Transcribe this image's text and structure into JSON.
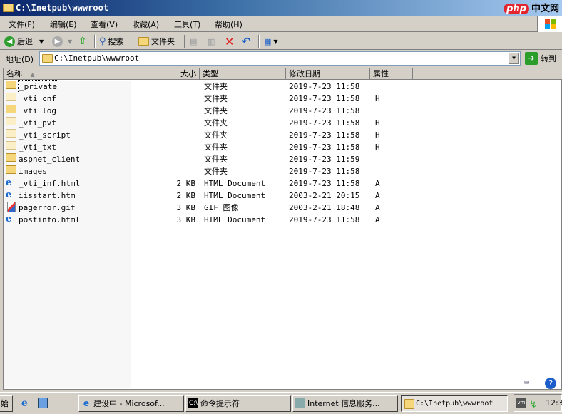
{
  "window": {
    "title": "C:\\Inetpub\\wwwroot",
    "watermark": "php中文网"
  },
  "menu": [
    "文件(F)",
    "编辑(E)",
    "查看(V)",
    "收藏(A)",
    "工具(T)",
    "帮助(H)"
  ],
  "toolbar": {
    "back": "后退",
    "search": "搜索",
    "folders": "文件夹"
  },
  "address": {
    "label": "地址(D)",
    "value": "C:\\Inetpub\\wwwroot",
    "go": "转到"
  },
  "columns": [
    "名称",
    "大小",
    "类型",
    "修改日期",
    "属性"
  ],
  "files": [
    {
      "name": "_private",
      "size": "",
      "type": "文件夹",
      "date": "2019-7-23 11:58",
      "attr": "",
      "icon": "folder"
    },
    {
      "name": "_vti_cnf",
      "size": "",
      "type": "文件夹",
      "date": "2019-7-23 11:58",
      "attr": "H",
      "icon": "folder-hidden"
    },
    {
      "name": "_vti_log",
      "size": "",
      "type": "文件夹",
      "date": "2019-7-23 11:58",
      "attr": "",
      "icon": "folder"
    },
    {
      "name": "_vti_pvt",
      "size": "",
      "type": "文件夹",
      "date": "2019-7-23 11:58",
      "attr": "H",
      "icon": "folder-hidden"
    },
    {
      "name": "_vti_script",
      "size": "",
      "type": "文件夹",
      "date": "2019-7-23 11:58",
      "attr": "H",
      "icon": "folder-hidden"
    },
    {
      "name": "_vti_txt",
      "size": "",
      "type": "文件夹",
      "date": "2019-7-23 11:58",
      "attr": "H",
      "icon": "folder-hidden"
    },
    {
      "name": "aspnet_client",
      "size": "",
      "type": "文件夹",
      "date": "2019-7-23 11:59",
      "attr": "",
      "icon": "folder"
    },
    {
      "name": "images",
      "size": "",
      "type": "文件夹",
      "date": "2019-7-23 11:58",
      "attr": "",
      "icon": "folder"
    },
    {
      "name": "_vti_inf.html",
      "size": "2 KB",
      "type": "HTML Document",
      "date": "2019-7-23 11:58",
      "attr": "A",
      "icon": "html"
    },
    {
      "name": "iisstart.htm",
      "size": "2 KB",
      "type": "HTML Document",
      "date": "2003-2-21 20:15",
      "attr": "A",
      "icon": "html"
    },
    {
      "name": "pagerror.gif",
      "size": "3 KB",
      "type": "GIF 图像",
      "date": "2003-2-21 18:48",
      "attr": "A",
      "icon": "gif"
    },
    {
      "name": "postinfo.html",
      "size": "3 KB",
      "type": "HTML Document",
      "date": "2019-7-23 11:58",
      "attr": "A",
      "icon": "html"
    }
  ],
  "taskbar": {
    "start": "始",
    "items": [
      "建设中 - Microsof...",
      "命令提示符",
      "Internet 信息服务...",
      "C:\\Inetpub\\wwwroot"
    ],
    "clock": "12:3"
  }
}
